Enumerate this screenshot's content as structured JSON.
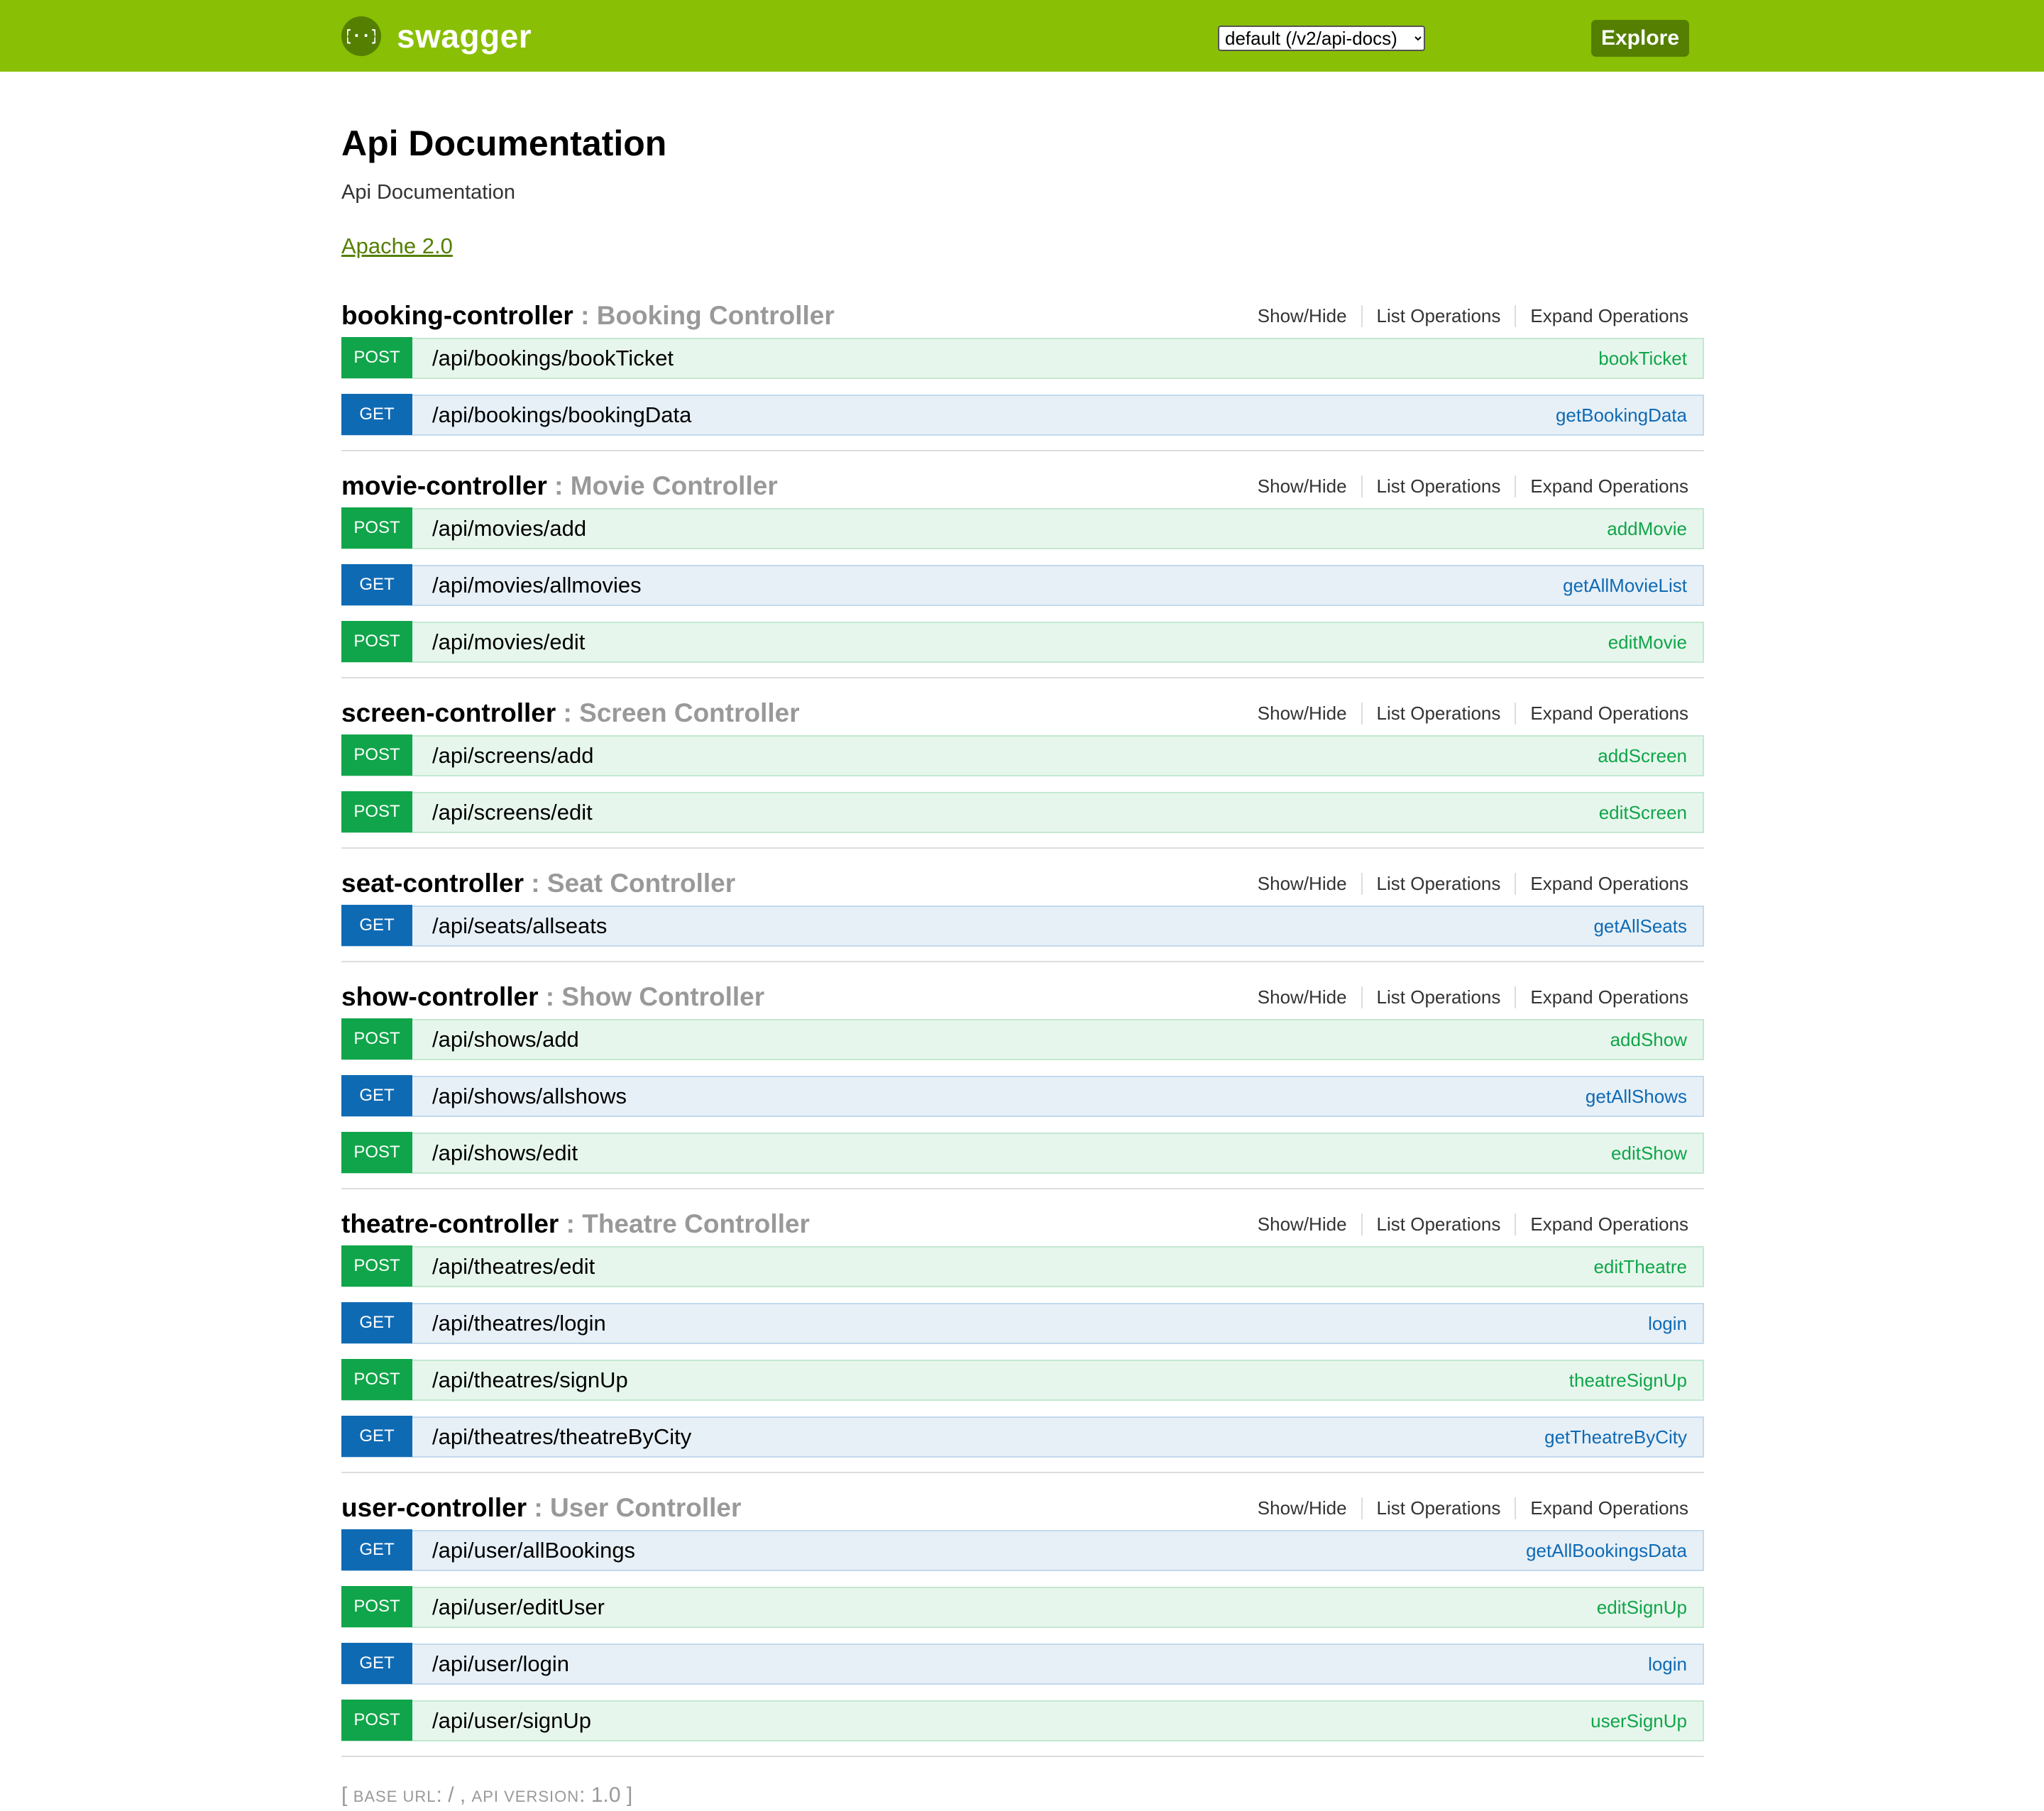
{
  "header": {
    "logo_text": "swagger",
    "spec_select_value": "default (/v2/api-docs)",
    "explore_label": "Explore",
    "brand_color": "#89bf04"
  },
  "info": {
    "title": "Api Documentation",
    "description": "Api Documentation",
    "license": "Apache 2.0"
  },
  "actions": {
    "show_hide": "Show/Hide",
    "list_operations": "List Operations",
    "expand_operations": "Expand Operations"
  },
  "colors": {
    "post": "#10a54a",
    "get": "#0f6ab4"
  },
  "resources": [
    {
      "name": "booking-controller",
      "description": "Booking Controller",
      "operations": [
        {
          "method": "POST",
          "path": "/api/bookings/bookTicket",
          "nickname": "bookTicket"
        },
        {
          "method": "GET",
          "path": "/api/bookings/bookingData",
          "nickname": "getBookingData"
        }
      ]
    },
    {
      "name": "movie-controller",
      "description": "Movie Controller",
      "operations": [
        {
          "method": "POST",
          "path": "/api/movies/add",
          "nickname": "addMovie"
        },
        {
          "method": "GET",
          "path": "/api/movies/allmovies",
          "nickname": "getAllMovieList"
        },
        {
          "method": "POST",
          "path": "/api/movies/edit",
          "nickname": "editMovie"
        }
      ]
    },
    {
      "name": "screen-controller",
      "description": "Screen Controller",
      "operations": [
        {
          "method": "POST",
          "path": "/api/screens/add",
          "nickname": "addScreen"
        },
        {
          "method": "POST",
          "path": "/api/screens/edit",
          "nickname": "editScreen"
        }
      ]
    },
    {
      "name": "seat-controller",
      "description": "Seat Controller",
      "operations": [
        {
          "method": "GET",
          "path": "/api/seats/allseats",
          "nickname": "getAllSeats"
        }
      ]
    },
    {
      "name": "show-controller",
      "description": "Show Controller",
      "operations": [
        {
          "method": "POST",
          "path": "/api/shows/add",
          "nickname": "addShow"
        },
        {
          "method": "GET",
          "path": "/api/shows/allshows",
          "nickname": "getAllShows"
        },
        {
          "method": "POST",
          "path": "/api/shows/edit",
          "nickname": "editShow"
        }
      ]
    },
    {
      "name": "theatre-controller",
      "description": "Theatre Controller",
      "operations": [
        {
          "method": "POST",
          "path": "/api/theatres/edit",
          "nickname": "editTheatre"
        },
        {
          "method": "GET",
          "path": "/api/theatres/login",
          "nickname": "login"
        },
        {
          "method": "POST",
          "path": "/api/theatres/signUp",
          "nickname": "theatreSignUp"
        },
        {
          "method": "GET",
          "path": "/api/theatres/theatreByCity",
          "nickname": "getTheatreByCity"
        }
      ]
    },
    {
      "name": "user-controller",
      "description": "User Controller",
      "operations": [
        {
          "method": "GET",
          "path": "/api/user/allBookings",
          "nickname": "getAllBookingsData"
        },
        {
          "method": "POST",
          "path": "/api/user/editUser",
          "nickname": "editSignUp"
        },
        {
          "method": "GET",
          "path": "/api/user/login",
          "nickname": "login"
        },
        {
          "method": "POST",
          "path": "/api/user/signUp",
          "nickname": "userSignUp"
        }
      ]
    }
  ],
  "footer": {
    "open_bracket": "[",
    "base_url_label": "base url",
    "base_url_value": "/",
    "api_version_label": "api version",
    "api_version_value": "1.0",
    "close_bracket": "]"
  }
}
